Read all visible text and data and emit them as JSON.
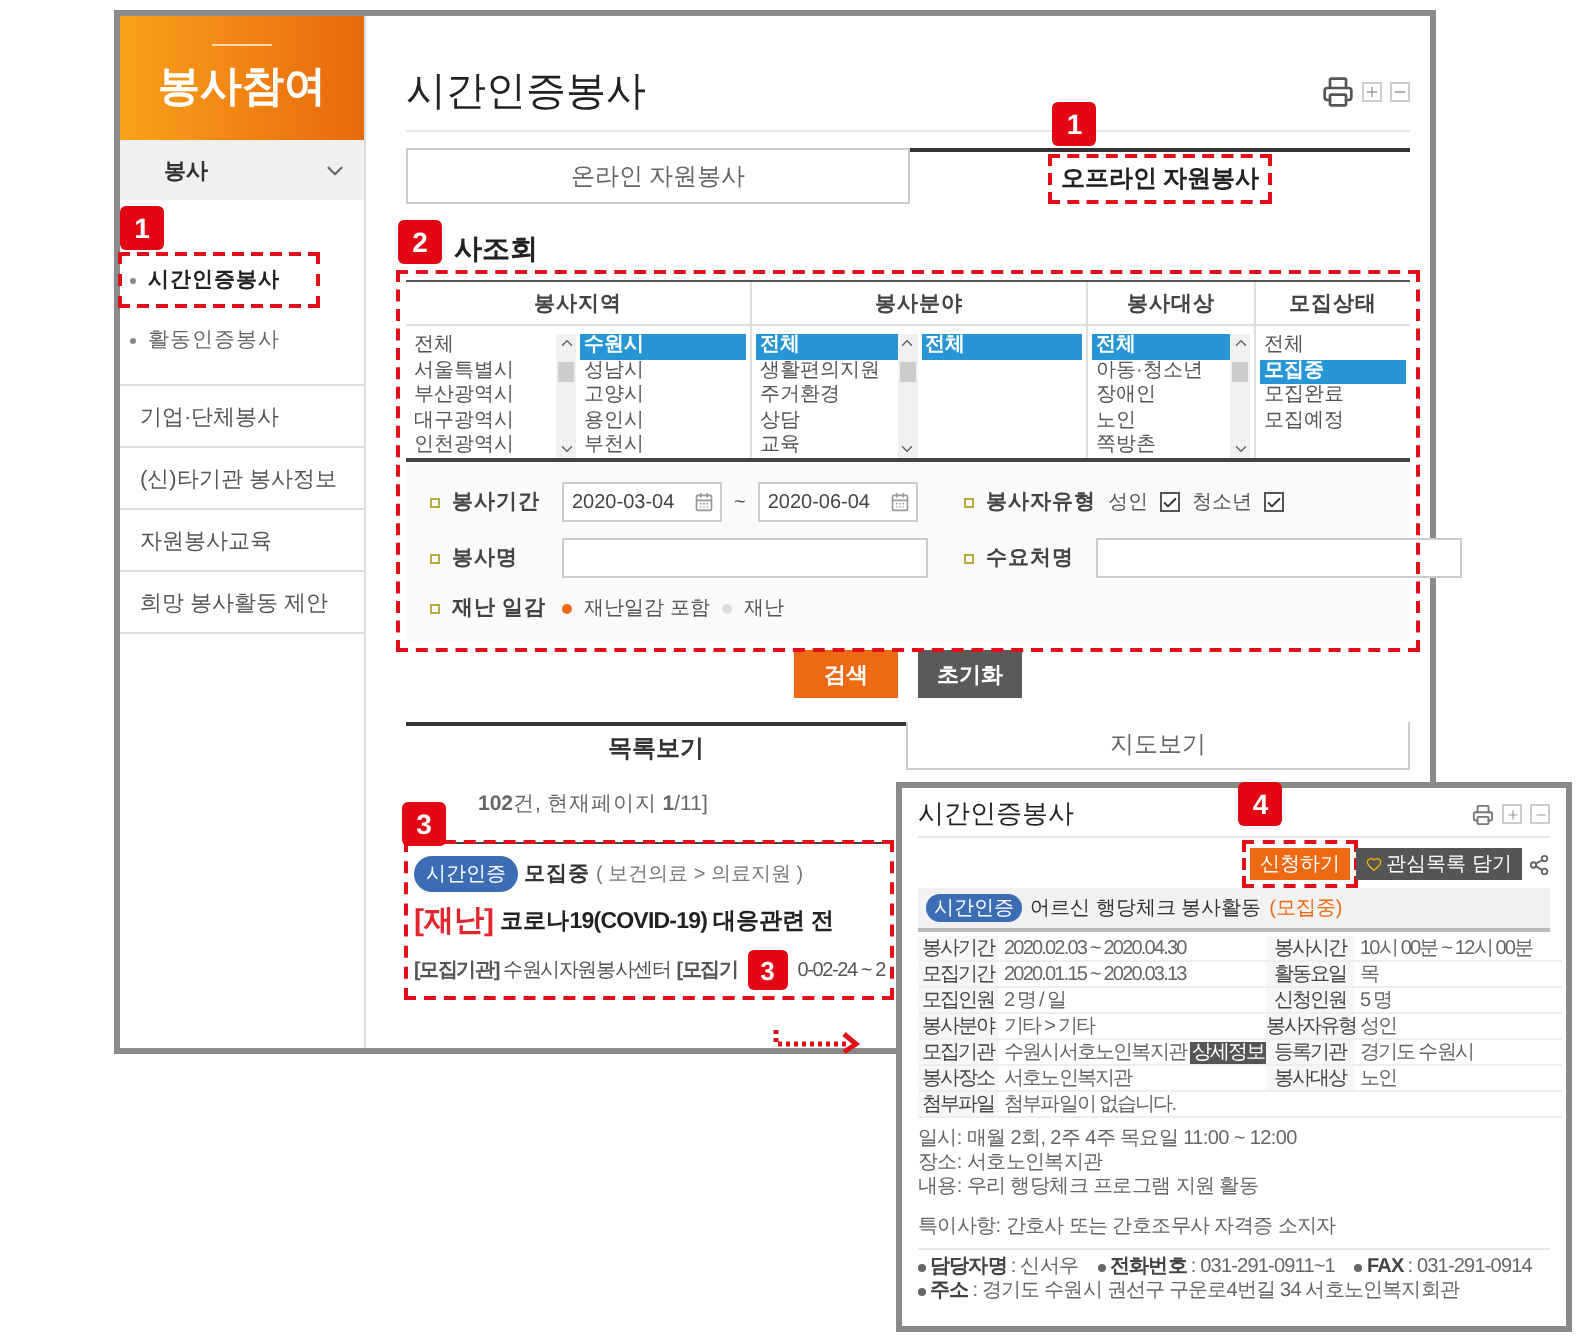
{
  "sidebar": {
    "title": "봉사참여",
    "group": {
      "label": "봉사",
      "expanded": true,
      "children": [
        {
          "label": "시간인증봉사",
          "selected": true,
          "marker": "1"
        },
        {
          "label": "활동인증봉사",
          "selected": false
        }
      ]
    },
    "items": [
      {
        "label": "기업·단체봉사"
      },
      {
        "label": "(신)타기관 봉사정보"
      },
      {
        "label": "자원봉사교육"
      },
      {
        "label": "희망 봉사활동 제안"
      }
    ]
  },
  "page": {
    "title": "시간인증봉사",
    "tabs": [
      {
        "label": "온라인 자원봉사",
        "selected": false
      },
      {
        "label": "오프라인 자원봉사",
        "selected": true,
        "marker": "1"
      }
    ],
    "section": {
      "title": "사조회",
      "marker": "2"
    },
    "filter_columns": [
      {
        "header": "봉사지역",
        "lists": [
          {
            "items": [
              {
                "label": "전체",
                "selected": false
              },
              {
                "label": "서울특별시",
                "selected": false
              },
              {
                "label": "부산광역시",
                "selected": false
              },
              {
                "label": "대구광역시",
                "selected": false
              },
              {
                "label": "인천광역시",
                "selected": false
              }
            ]
          },
          {
            "items": [
              {
                "label": "수원시",
                "selected": true
              },
              {
                "label": "성남시",
                "selected": false
              },
              {
                "label": "고양시",
                "selected": false
              },
              {
                "label": "용인시",
                "selected": false
              },
              {
                "label": "부천시",
                "selected": false
              }
            ]
          }
        ]
      },
      {
        "header": "봉사분야",
        "lists": [
          {
            "items": [
              {
                "label": "전체",
                "selected": true
              },
              {
                "label": "생활편의지원",
                "selected": false
              },
              {
                "label": "주거환경",
                "selected": false
              },
              {
                "label": "상담",
                "selected": false
              },
              {
                "label": "교육",
                "selected": false
              }
            ]
          },
          {
            "items": [
              {
                "label": "전체",
                "selected": true
              }
            ]
          }
        ]
      },
      {
        "header": "봉사대상",
        "lists": [
          {
            "items": [
              {
                "label": "전체",
                "selected": true
              },
              {
                "label": "아동·청소년",
                "selected": false
              },
              {
                "label": "장애인",
                "selected": false
              },
              {
                "label": "노인",
                "selected": false
              },
              {
                "label": "쪽방촌",
                "selected": false
              }
            ]
          }
        ]
      },
      {
        "header": "모집상태",
        "lists": [
          {
            "items": [
              {
                "label": "전체",
                "selected": false
              },
              {
                "label": "모집중",
                "selected": true
              },
              {
                "label": "모집완료",
                "selected": false
              },
              {
                "label": "모집예정",
                "selected": false
              }
            ]
          }
        ]
      }
    ],
    "form": {
      "period": {
        "label": "봉사기간",
        "from": "2020-03-04",
        "separator": "~",
        "to": "2020-06-04"
      },
      "volunteer_type": {
        "label": "봉사자유형",
        "options": [
          {
            "label": "성인",
            "checked": true
          },
          {
            "label": "청소년",
            "checked": true
          }
        ]
      },
      "name": {
        "label": "봉사명"
      },
      "client": {
        "label": "수요처명"
      },
      "disaster": {
        "label": "재난 일감",
        "options": [
          {
            "label": "재난일감 포함",
            "selected": true
          },
          {
            "label": "재난",
            "selected": false
          }
        ]
      }
    },
    "buttons": [
      {
        "label": "검색",
        "kind": "primary"
      },
      {
        "label": "초기화",
        "kind": "secondary"
      }
    ],
    "view_tabs": [
      {
        "label": "목록보기",
        "selected": true
      },
      {
        "label": "지도보기",
        "selected": false
      }
    ],
    "count": "**102**건, 현재페이지 **1**/11]",
    "result": {
      "marker": "3",
      "badge": "시간인증",
      "status": "모집중",
      "category": "( 보건의료  > 의료지원 )",
      "tag": "[재난]",
      "title": "코로나19(COVID-19) 대응관련 전",
      "meta": [
        {
          "text": "**[모집기관]** 수원시자원봉사센터"
        },
        {
          "text": "**[모집기**",
          "marker": "3",
          "after": "0-02-24 ~ 2"
        }
      ]
    }
  },
  "popup": {
    "title": "시간인증봉사",
    "actions": [
      {
        "label": "신청하기",
        "kind": "primary",
        "marker": "4"
      },
      {
        "label": "관심목록 담기",
        "kind": "secondary"
      }
    ],
    "badge": "시간인증",
    "headline": "어르신 행당체크 봉사활동",
    "status": "(모집중)",
    "rows": [
      [
        {
          "label": "봉사기간",
          "value": "2020.02.03 ~ 2020.04.30"
        },
        {
          "label": "봉사시간",
          "value": "10시 00분 ~ 12시 00분"
        }
      ],
      [
        {
          "label": "모집기간",
          "value": "2020.01.15 ~ 2020.03.13"
        },
        {
          "label": "활동요일",
          "value": "목"
        }
      ],
      [
        {
          "label": "모집인원",
          "value": "2 명 / 일"
        },
        {
          "label": "신청인원",
          "value": "5 명"
        }
      ],
      [
        {
          "label": "봉사분야",
          "value": "기타 > 기타"
        },
        {
          "label": "봉사자유형",
          "value": "성인"
        }
      ],
      [
        {
          "label": "모집기관",
          "value": "수원시서호노인복지관",
          "button": "상세정보"
        },
        {
          "label": "등록기관",
          "value": "경기도 수원시"
        }
      ],
      [
        {
          "label": "봉사장소",
          "value": "서호노인복지관"
        },
        {
          "label": "봉사대상",
          "value": "노인"
        }
      ],
      [
        {
          "label": "첨부파일",
          "value": "첨부파일이 없습니다."
        }
      ]
    ],
    "body": [
      "일시: 매월 2회, 2주 4주 목요일 11:00 ~ 12:00",
      "장소: 서호노인복지관",
      "내용: 우리 행당체크 프로그램 지원 활동",
      "특이사항: 간호사 또는 간호조무사 자격증 소지자"
    ],
    "contacts": [
      {
        "label": "담당자명",
        "value": ": 신서우"
      },
      {
        "label": "전화번호",
        "value": ": 031-291-0911~1"
      },
      {
        "label": "FAX",
        "value": ": 031-291-0914"
      },
      {
        "label": "주소",
        "value": ": 경기도 수원시 권선구 구운로4번길 34 서호노인복지회관"
      }
    ]
  }
}
